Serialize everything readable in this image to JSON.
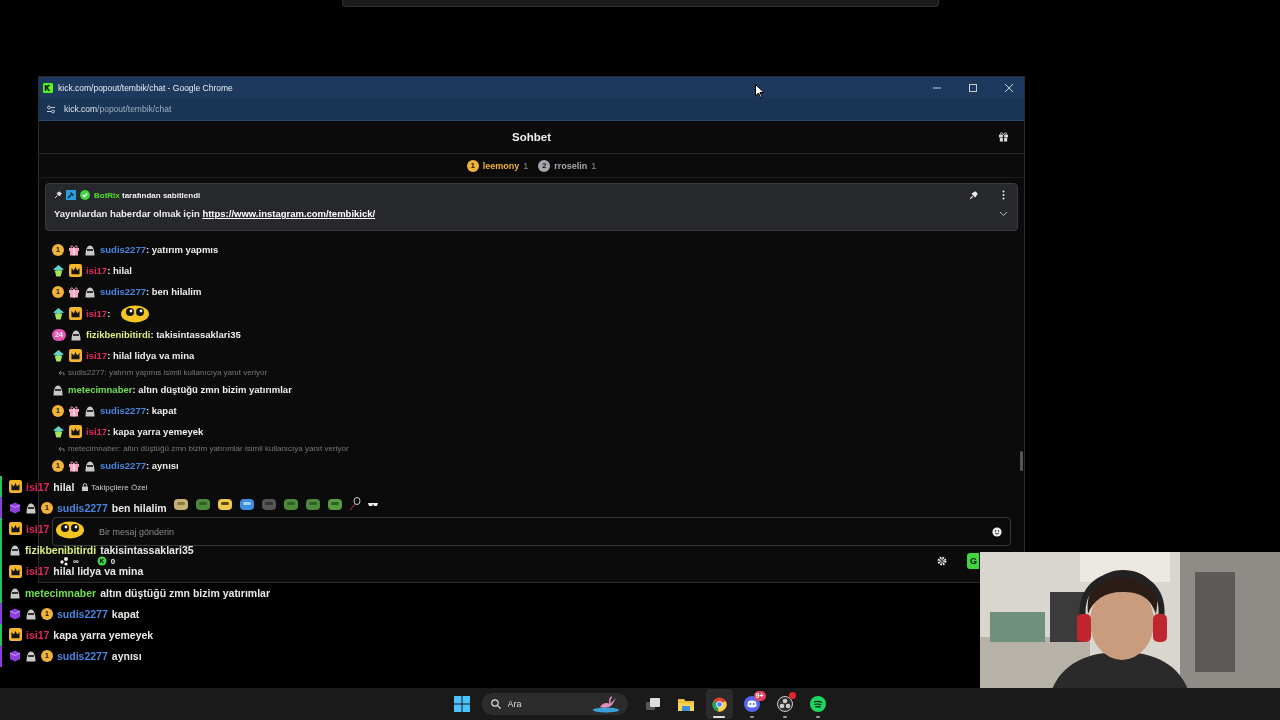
{
  "window": {
    "title": "kick.com/popout/tembik/chat - Google Chrome",
    "address": {
      "host": "kick.com",
      "path": "/popout/tembik/chat"
    }
  },
  "chat": {
    "title": "Sohbet",
    "leaders": [
      {
        "rank": "1",
        "name": "leemony",
        "count": "1",
        "color": "#f0b23a"
      },
      {
        "rank": "2",
        "name": "rroselin",
        "count": "1",
        "color": "#a4a8ad"
      }
    ],
    "pinned": {
      "pinner": "BotRix",
      "note": " tarafından sabitlendi",
      "text": "Yayınlardan haberdar olmak için ",
      "link": "https://www.instagram.com/tembikick/"
    },
    "messages": [
      {
        "kind": "text",
        "badges": [
          {
            "kind": "subscriber",
            "label": "1"
          },
          {
            "kind": "gift"
          },
          {
            "kind": "masked"
          }
        ],
        "user": "sudis2277",
        "color": "#4a86e0",
        "text": ": yatırım yapmıs"
      },
      {
        "kind": "text",
        "badges": [
          {
            "kind": "gem"
          },
          {
            "kind": "crown"
          }
        ],
        "user": "isi17",
        "color": "#e5265c",
        "text": ": hilal"
      },
      {
        "kind": "text",
        "badges": [
          {
            "kind": "subscriber",
            "label": "1"
          },
          {
            "kind": "gift"
          },
          {
            "kind": "masked"
          }
        ],
        "user": "sudis2277",
        "color": "#4a86e0",
        "text": ": ben hilalim"
      },
      {
        "kind": "emote",
        "badges": [
          {
            "kind": "gem"
          },
          {
            "kind": "crown"
          }
        ],
        "user": "isi17",
        "color": "#e5265c",
        "text": ":"
      },
      {
        "kind": "text",
        "badges": [
          {
            "kind": "months",
            "label": "24"
          },
          {
            "kind": "masked"
          }
        ],
        "user": "fizikbenibitirdi",
        "color": "#d8f07c",
        "text": ": takisintassaklari35"
      },
      {
        "kind": "text",
        "badges": [
          {
            "kind": "gem"
          },
          {
            "kind": "crown"
          }
        ],
        "user": "isi17",
        "color": "#e5265c",
        "text": ": hilal lidya va mina"
      },
      {
        "kind": "text",
        "reply": "sudis2277: yatırım yapmıs isimli kullanıcıya yanıt veriyor",
        "badges": [
          {
            "kind": "masked"
          }
        ],
        "user": "metecimnaber",
        "color": "#72e04c",
        "text": ": altın düştüğü zmn bizim yatırımlar"
      },
      {
        "kind": "text",
        "badges": [
          {
            "kind": "subscriber",
            "label": "1"
          },
          {
            "kind": "gift"
          },
          {
            "kind": "masked"
          }
        ],
        "user": "sudis2277",
        "color": "#4a86e0",
        "text": ": kapat"
      },
      {
        "kind": "text",
        "badges": [
          {
            "kind": "gem"
          },
          {
            "kind": "crown"
          }
        ],
        "user": "isi17",
        "color": "#e5265c",
        "text": ": kapa yarra yemeyek"
      },
      {
        "kind": "text",
        "reply": "metecimnaber: altın düştüğü zmn bizim yatırımlar isimli kullanıcıya yanıt veriyor",
        "badges": [
          {
            "kind": "subscriber",
            "label": "1"
          },
          {
            "kind": "gift"
          },
          {
            "kind": "masked"
          }
        ],
        "user": "sudis2277",
        "color": "#4a86e0",
        "text": ": aynısı"
      }
    ],
    "followers_only": "Takipçilere Özel",
    "input": {
      "placeholder": "Bir mesaj gönderin"
    },
    "footer": {
      "infinity": "∞",
      "points": "0",
      "send": "G"
    }
  },
  "overlay": [
    {
      "kind": "text",
      "color": "#22c55e",
      "badges": [
        {
          "kind": "crown"
        }
      ],
      "user": {
        "name": "isi17",
        "color": "#e5265c"
      },
      "text": "hilal"
    },
    {
      "kind": "text",
      "color": "#8b3fd9",
      "badges": [
        {
          "kind": "cube"
        },
        {
          "kind": "masked"
        },
        {
          "kind": "subscriber",
          "label": "1"
        }
      ],
      "user": {
        "name": "sudis2277",
        "color": "#4a86e0"
      },
      "text": "ben hilalim"
    },
    {
      "kind": "emote",
      "color": "#22c55e",
      "badges": [
        {
          "kind": "crown"
        }
      ],
      "user": {
        "name": "isi17",
        "color": "#e5265c"
      }
    },
    {
      "kind": "text",
      "color": "#22c55e",
      "badges": [
        {
          "kind": "masked"
        }
      ],
      "user": {
        "name": "fizikbenibitirdi",
        "color": "#d8f07c"
      },
      "text": "takisintassaklari35"
    },
    {
      "kind": "text",
      "color": "#22c55e",
      "badges": [
        {
          "kind": "crown"
        }
      ],
      "user": {
        "name": "isi17",
        "color": "#e5265c"
      },
      "text": "hilal lidya va mina"
    },
    {
      "kind": "text",
      "color": "#22c55e",
      "badges": [
        {
          "kind": "masked"
        }
      ],
      "user": {
        "name": "metecimnaber",
        "color": "#72e04c"
      },
      "text": "altın düştüğü zmn bizim yatırımlar"
    },
    {
      "kind": "text",
      "color": "#8b3fd9",
      "badges": [
        {
          "kind": "cube"
        },
        {
          "kind": "masked"
        },
        {
          "kind": "subscriber",
          "label": "1"
        }
      ],
      "user": {
        "name": "sudis2277",
        "color": "#4a86e0"
      },
      "text": "kapat"
    },
    {
      "kind": "text",
      "color": "#22c55e",
      "badges": [
        {
          "kind": "crown"
        }
      ],
      "user": {
        "name": "isi17",
        "color": "#e5265c"
      },
      "text": "kapa yarra yemeyek"
    },
    {
      "kind": "text",
      "color": "#8b3fd9",
      "badges": [
        {
          "kind": "cube"
        },
        {
          "kind": "masked"
        },
        {
          "kind": "subscriber",
          "label": "1"
        }
      ],
      "user": {
        "name": "sudis2277",
        "color": "#4a86e0"
      },
      "text": "aynısı"
    }
  ],
  "taskbar": {
    "search": {
      "placeholder": "Ara"
    },
    "apps": [
      {
        "kind": "taskview",
        "active": false,
        "running": false,
        "alert": false
      },
      {
        "kind": "files",
        "active": false,
        "running": false,
        "alert": false
      },
      {
        "kind": "chrome",
        "active": true,
        "running": true,
        "alert": false
      },
      {
        "kind": "discord",
        "active": false,
        "running": true,
        "alert": false,
        "badge": "9+"
      },
      {
        "kind": "obs",
        "active": false,
        "running": true,
        "alert": true
      },
      {
        "kind": "spotify",
        "active": false,
        "running": true,
        "alert": false
      }
    ]
  }
}
